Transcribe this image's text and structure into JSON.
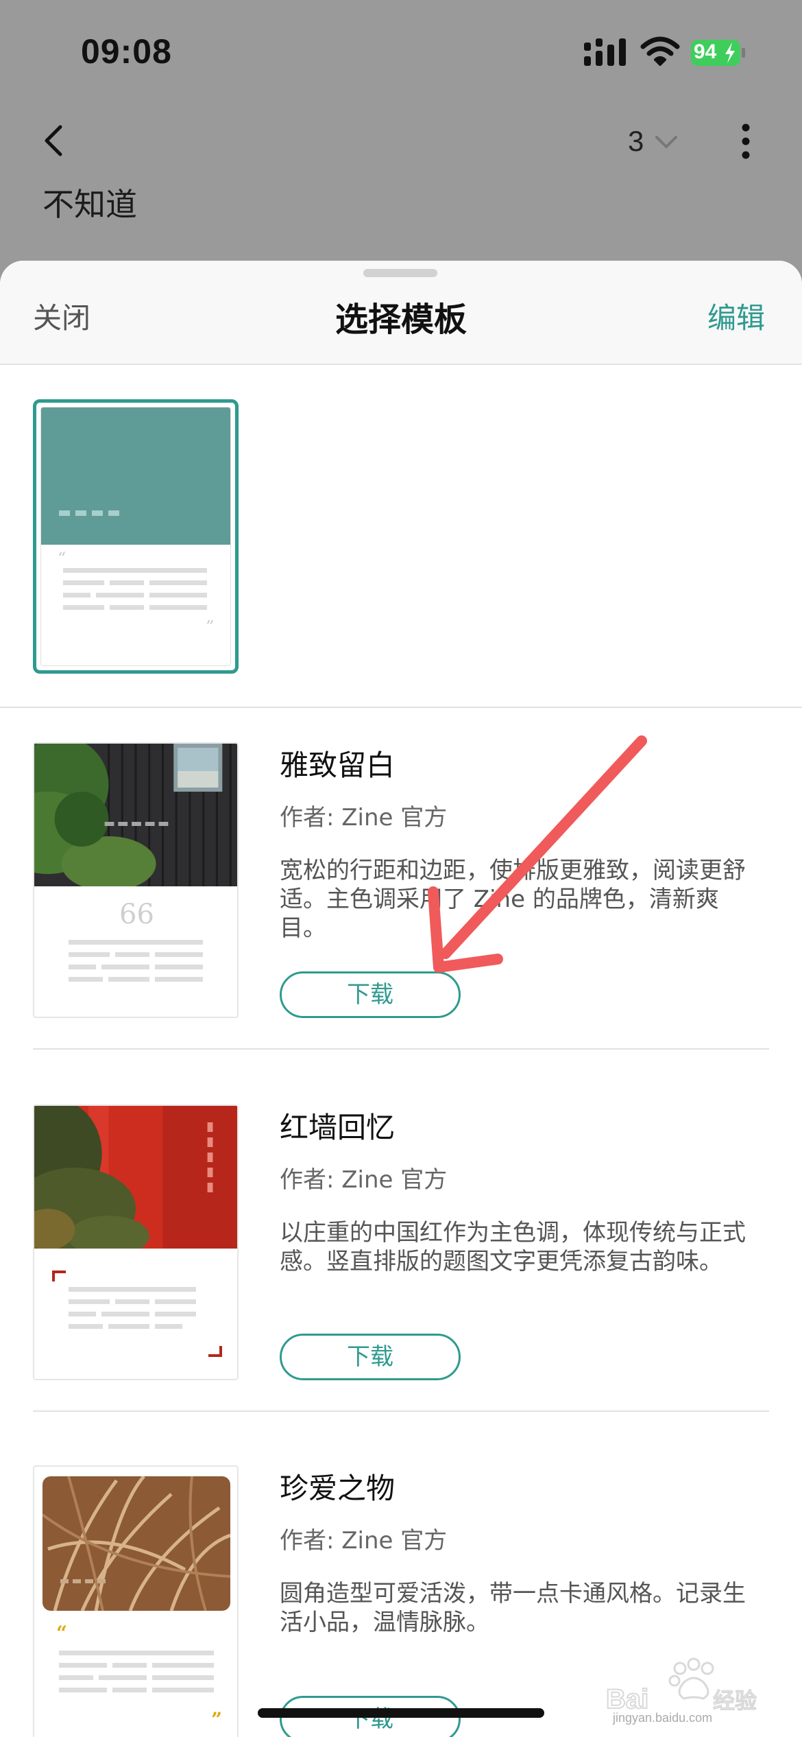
{
  "status_bar": {
    "time": "09:08",
    "battery": "94"
  },
  "background_page": {
    "page_number": "3",
    "title": "不知道"
  },
  "sheet": {
    "close_label": "关闭",
    "title": "选择模板",
    "edit_label": "编辑"
  },
  "templates": [
    {
      "name": "雅致留白",
      "author": "作者: Zine 官方",
      "description": "宽松的行距和边距，使排版更雅致，阅读更舒适。主色调采用了 Zine 的品牌色，清新爽目。",
      "download_label": "下载"
    },
    {
      "name": "红墙回忆",
      "author": "作者: Zine 官方",
      "description": "以庄重的中国红作为主色调，体现传统与正式感。竖直排版的题图文字更凭添复古韵味。",
      "download_label": "下载"
    },
    {
      "name": "珍爱之物",
      "author": "作者: Zine 官方",
      "description": "圆角造型可爱活泼，带一点卡通风格。记录生活小品，温情脉脉。",
      "download_label": "下载"
    }
  ],
  "watermark": {
    "text": "jingyan.baidu.com"
  },
  "colors": {
    "accent": "#2f9a90",
    "annotation_arrow": "#f05a5a"
  }
}
